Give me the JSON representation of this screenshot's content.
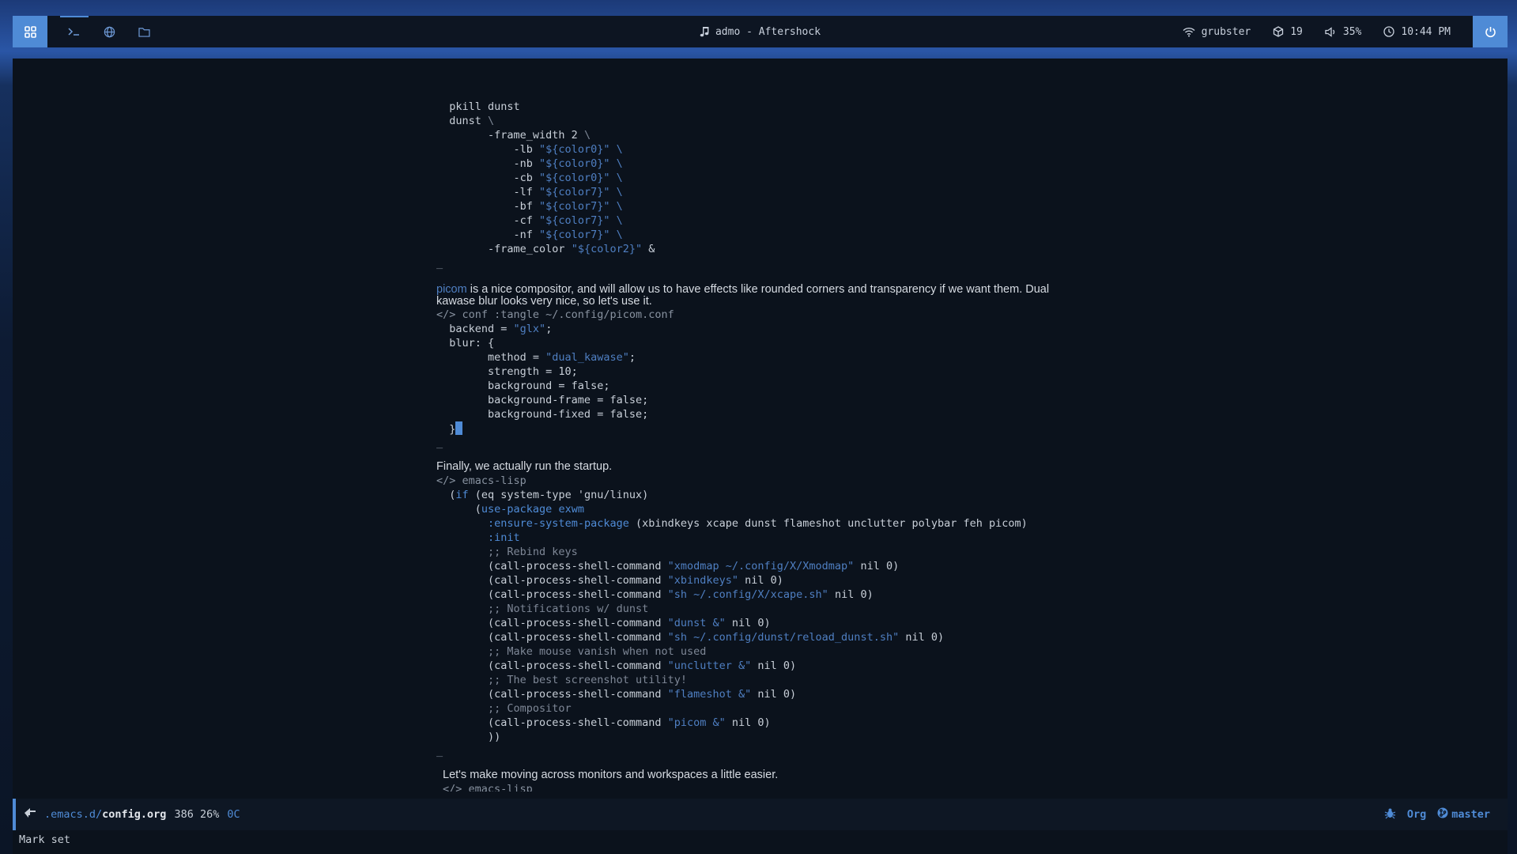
{
  "topbar": {
    "now_playing": "admo - Aftershock",
    "wifi": "grubster",
    "updates": "19",
    "volume": "35%",
    "clock": "10:44 PM"
  },
  "buffer": {
    "lines": {
      "l1": "  pkill dunst",
      "l2a": "  dunst ",
      "l2b": "\\",
      "l3a": "        -frame_width 2 ",
      "l3b": "\\",
      "d1a": "            -lb ",
      "d1b": "\"${color0}\" \\",
      "d2a": "            -nb ",
      "d2b": "\"${color0}\" \\",
      "d3a": "            -cb ",
      "d3b": "\"${color0}\" \\",
      "d4a": "            -lf ",
      "d4b": "\"${color7}\" \\",
      "d5a": "            -bf ",
      "d5b": "\"${color7}\" \\",
      "d6a": "            -cf ",
      "d6b": "\"${color7}\" \\",
      "d7a": "            -nf ",
      "d7b": "\"${color7}\" \\",
      "fc_a": "        -frame_color ",
      "fc_b": "\"${color2}\"",
      "fc_c": " &",
      "end1": "_"
    },
    "picom_link": "picom",
    "picom_text": " is a nice compositor, and will allow us to have effects like rounded corners and transparency if we want them. Dual kawase blur looks very nice, so let's use it.",
    "picom_header": "</> conf :tangle ~/.config/picom.conf",
    "p_backend_a": "  backend = ",
    "p_backend_b": "\"glx\"",
    "p_backend_c": ";",
    "p_blur": "  blur: {",
    "p_method_a": "        method = ",
    "p_method_b": "\"dual_kawase\"",
    "p_method_c": ";",
    "p_strength": "        strength = 10;",
    "p_bg": "        background = false;",
    "p_bgframe": "        background-frame = false;",
    "p_bgfixed": "        background-fixed = false;",
    "p_close": "  }",
    "end2": "_",
    "startup_text": "Finally, we actually run the startup.",
    "lisp_header": "</> emacs-lisp",
    "e1a": "  (",
    "e1b": "if",
    "e1c": " (eq system-type 'gnu/linux)",
    "e2a": "      (",
    "e2b": "use-package exwm",
    "e3a": "        ",
    "e3b": ":ensure-system-package",
    "e3c": " (xbindkeys xcape dunst flameshot unclutter polybar feh picom)",
    "e4a": "        ",
    "e4b": ":init",
    "c1": "        ;; Rebind keys",
    "cp1a": "        (call-process-shell-command ",
    "cp1b": "\"xmodmap ~/.config/X/Xmodmap\"",
    "cp1c": " nil 0)",
    "cp2a": "        (call-process-shell-command ",
    "cp2b": "\"xbindkeys\"",
    "cp2c": " nil 0)",
    "cp3a": "        (call-process-shell-command ",
    "cp3b": "\"sh ~/.config/X/xcape.sh\"",
    "cp3c": " nil 0)",
    "c2": "        ;; Notifications w/ dunst",
    "cp4a": "        (call-process-shell-command ",
    "cp4b": "\"dunst &\"",
    "cp4c": " nil 0)",
    "cp5a": "        (call-process-shell-command ",
    "cp5b": "\"sh ~/.config/dunst/reload_dunst.sh\"",
    "cp5c": " nil 0)",
    "c3": "        ;; Make mouse vanish when not used",
    "cp6a": "        (call-process-shell-command ",
    "cp6b": "\"unclutter &\"",
    "cp6c": " nil 0)",
    "c4": "        ;; The best screenshot utility!",
    "cp7a": "        (call-process-shell-command ",
    "cp7b": "\"flameshot &\"",
    "cp7c": " nil 0)",
    "c5": "        ;; Compositor",
    "cp8a": "        (call-process-shell-command ",
    "cp8b": "\"picom &\"",
    "cp8c": " nil 0)",
    "close": "        ))",
    "end3": "_",
    "monitors_text": "Let's make moving across monitors and workspaces a little easier.",
    "lisp_header2": "</> emacs-lisp"
  },
  "modeline": {
    "path_dir": ".emacs.d/",
    "path_file": "config.org",
    "position": "386 26%",
    "column": "0C",
    "major_mode": "Org",
    "branch": "master"
  },
  "echo_area": "Mark set",
  "colors": {
    "accent": "#4f8bd6",
    "string": "#4f7fc2",
    "comment": "#7e8796",
    "bg": "#0b121c"
  }
}
